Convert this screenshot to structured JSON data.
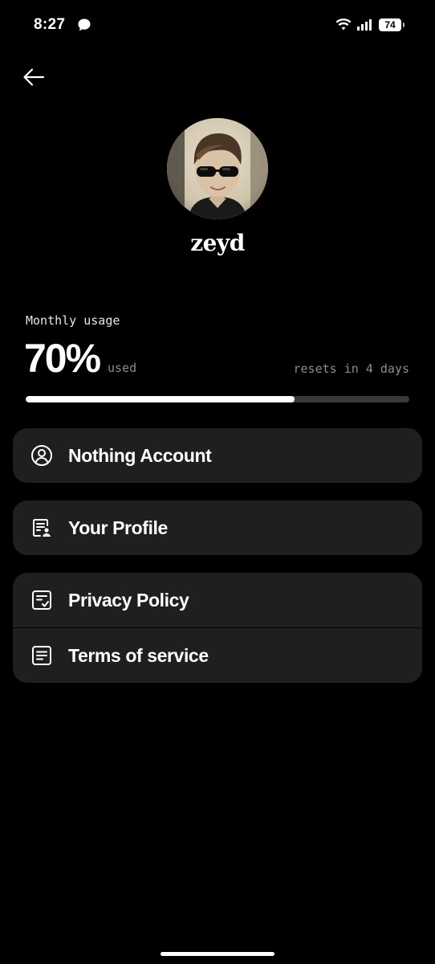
{
  "status_bar": {
    "time": "8:27",
    "battery": "74",
    "icons": [
      "chat-bubble-icon",
      "wifi-icon",
      "signal-icon",
      "battery-icon"
    ]
  },
  "header": {
    "back_icon": "arrow-left-icon"
  },
  "profile": {
    "username": "zeyd"
  },
  "usage": {
    "label": "Monthly usage",
    "percent_text": "70%",
    "used_label": "used",
    "reset_text": "resets in 4 days",
    "progress_fraction": 0.7
  },
  "menu": {
    "account": {
      "label": "Nothing Account",
      "icon": "user-circle-icon"
    },
    "profile": {
      "label": "Your Profile",
      "icon": "profile-card-icon"
    },
    "privacy": {
      "label": "Privacy Policy",
      "icon": "policy-check-icon"
    },
    "terms": {
      "label": "Terms of service",
      "icon": "document-lines-icon"
    }
  },
  "colors": {
    "background": "#000000",
    "card": "#1f1f1f",
    "text": "#ffffff",
    "muted": "#8c8c8c",
    "progress_track": "#3a3a3a"
  }
}
